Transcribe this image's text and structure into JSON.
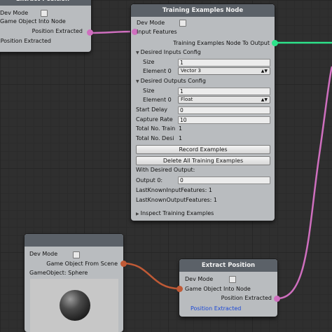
{
  "colors": {
    "background": "#2f2f2f",
    "node_body": "#b9bcbf",
    "node_header": "#5b6168",
    "wire_pink": "#cf6fbf",
    "wire_green": "#2de38a",
    "wire_orange": "#c05a36",
    "link_blue": "#1c49d6"
  },
  "extract_position_top": {
    "title": "Extract Position",
    "dev_mode": "Dev Mode",
    "input": "Game Object Into Node",
    "output": "Position Extracted",
    "foldout": "Position Extracted"
  },
  "training_node": {
    "title": "Training Examples Node",
    "dev_mode": "Dev Mode",
    "input_features": "Input Features",
    "output": "Training Examples Node To Output",
    "desired_inputs_config": "Desired Inputs Config",
    "inputs_size_label": "Size",
    "inputs_size_value": "1",
    "inputs_element_label": "Element 0",
    "inputs_element_value": "Vector 3",
    "desired_outputs_config": "Desired Outputs Config",
    "outputs_size_label": "Size",
    "outputs_size_value": "1",
    "outputs_element_label": "Element 0",
    "outputs_element_value": "Float",
    "start_delay_label": "Start Delay",
    "start_delay_value": "0",
    "capture_rate_label": "Capture Rate",
    "capture_rate_value": "10",
    "total_train_label": "Total No. Train",
    "total_train_value": "1",
    "total_desired_label": "Total No. Desi",
    "total_desired_value": "1",
    "record_button": "Record Examples",
    "delete_button": "Delete All Training Examples",
    "with_desired_output": "With Desired Output:",
    "output0_label": "Output 0:",
    "output0_value": "0",
    "last_known_input": "LastKnownInputFeatures: 1",
    "last_known_output": "LastKnownOutputFeatures: 1",
    "inspect": "Inspect Training Examples"
  },
  "game_object_node": {
    "dev_mode": "Dev Mode",
    "output": "Game Object From Scene",
    "game_object": "GameObject: Sphere"
  },
  "extract_position_bottom": {
    "title": "Extract Position",
    "dev_mode": "Dev Mode",
    "input": "Game Object Into Node",
    "output": "Position Extracted",
    "link": "Position Extracted"
  }
}
